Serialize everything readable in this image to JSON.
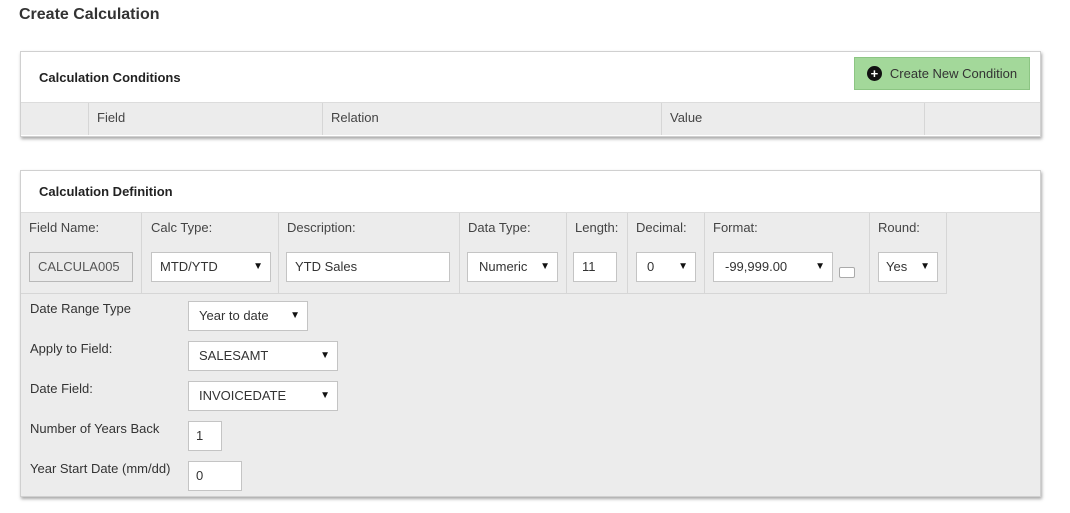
{
  "page": {
    "title": "Create Calculation"
  },
  "conditions": {
    "title": "Calculation Conditions",
    "new_button": {
      "label": "Create New Condition",
      "icon": "plus-circle-icon"
    },
    "columns": [
      "",
      "Field",
      "Relation",
      "Value",
      ""
    ]
  },
  "definition": {
    "title": "Calculation Definition",
    "headers": {
      "field_name": "Field Name:",
      "calc_type": "Calc Type:",
      "description": "Description:",
      "data_type": "Data Type:",
      "length": "Length:",
      "decimal": "Decimal:",
      "format": "Format:",
      "round": "Round:"
    },
    "values": {
      "field_name": "CALCULA005",
      "calc_type": "MTD/YTD",
      "description": "YTD Sales",
      "data_type": "Numeric",
      "length": "11",
      "decimal": "0",
      "format": "-99,999.00",
      "round": "Yes"
    },
    "form": {
      "date_range_type": {
        "label": "Date Range Type",
        "value": "Year to date"
      },
      "apply_to_field": {
        "label": "Apply to Field:",
        "value": "SALESAMT"
      },
      "date_field": {
        "label": "Date Field:",
        "value": "INVOICEDATE"
      },
      "years_back": {
        "label": "Number of Years Back",
        "value": "1"
      },
      "year_start": {
        "label": "Year Start Date (mm/dd)",
        "value": "0"
      }
    }
  },
  "colors": {
    "button_green": "#a3d89a",
    "panel_gray": "#ececec"
  }
}
